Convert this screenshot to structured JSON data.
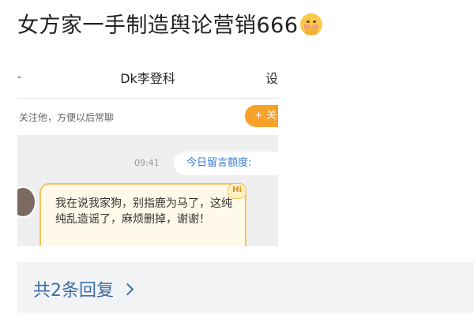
{
  "post": {
    "title": "女方家一手制造舆论营销666",
    "emoji_icon": "face-with-hand-over-mouth-icon"
  },
  "screenshot": {
    "nav": {
      "back_label": "-",
      "title": "Dk李登科",
      "right_label": "设"
    },
    "follow_bar": {
      "text": "关注他，方便以后常聊",
      "button_label": "+ 关"
    },
    "chat": {
      "time": "09:41",
      "quota_text": "今日留言额度:",
      "message": "我在说我家狗，别指鹿为马了，这纯纯乱造谣了，麻烦删掉，谢谢！",
      "badge": "Hi"
    }
  },
  "replies": {
    "label": "共2条回复"
  },
  "colors": {
    "link_blue": "#3d6da8",
    "follow_orange": "#f7a12b",
    "bubble_border": "#f1c45a"
  }
}
